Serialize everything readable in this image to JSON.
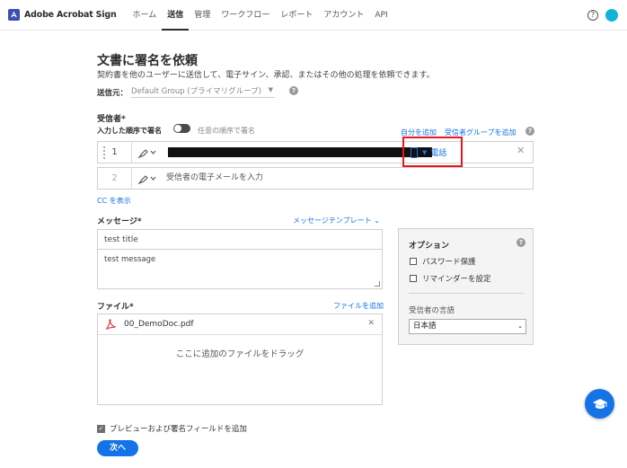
{
  "app": {
    "name": "Adobe Acrobat Sign",
    "brand_color": "#3c4fb3"
  },
  "nav": {
    "items": [
      {
        "label": "ホーム",
        "active": false
      },
      {
        "label": "送信",
        "active": true
      },
      {
        "label": "管理",
        "active": false
      },
      {
        "label": "ワークフロー",
        "active": false
      },
      {
        "label": "レポート",
        "active": false
      },
      {
        "label": "アカウント",
        "active": false
      },
      {
        "label": "API",
        "active": false
      }
    ],
    "help_glyph": "?"
  },
  "page": {
    "title": "文書に署名を依頼",
    "subtitle": "契約書を他のユーザーに送信して、電子サイン、承認、またはその他の処理を依頼できます。"
  },
  "sender": {
    "label": "送信元：",
    "value": "Default Group (プライマリグループ)"
  },
  "recipients": {
    "label": "受信者*",
    "order_label": "入力した順序で署名",
    "any_order_label": "任意の順序で署名",
    "add_self": "自分を追加",
    "add_group": "受信者グループを追加",
    "rows": [
      {
        "number": "1",
        "auth_label": "電話"
      },
      {
        "number": "2",
        "email_placeholder": "受信者の電子メールを入力"
      }
    ],
    "cc_link": "CC を表示"
  },
  "message": {
    "label": "メッセージ*",
    "template_link": "メッセージテンプレート",
    "title_value": "test title",
    "body_value": "test message"
  },
  "options": {
    "title": "オプション",
    "password_label": "パスワード保護",
    "reminder_label": "リマインダーを設定",
    "language_label": "受信者の言語",
    "language_value": "日本語"
  },
  "files": {
    "label": "ファイル*",
    "add_link": "ファイルを追加",
    "items": [
      {
        "name": "00_DemoDoc.pdf"
      }
    ],
    "drop_text": "ここに追加のファイルをドラッグ"
  },
  "footer": {
    "preview_label": "プレビューおよび署名フィールドを追加",
    "next_label": "次へ"
  },
  "colors": {
    "accent": "#1473e6",
    "highlight": "#e8161f"
  }
}
